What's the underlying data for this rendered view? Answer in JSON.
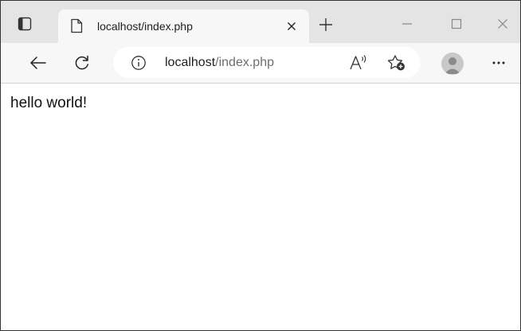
{
  "browser": {
    "tab": {
      "title": "localhost/index.php",
      "favicon_icon": "page-icon",
      "close_icon": "close-icon"
    },
    "new_tab_icon": "plus-icon",
    "window_controls": [
      "minimize-icon",
      "maximize-icon",
      "close-icon"
    ],
    "tab_actions_icon": "tab-actions-icon"
  },
  "toolbar": {
    "back_icon": "back-arrow-icon",
    "refresh_icon": "refresh-icon",
    "address": {
      "host": "localhost",
      "path": "/index.php",
      "info_icon": "info-icon"
    },
    "read_aloud_icon": "read-aloud-icon",
    "favorites_icon": "add-favorite-icon",
    "profile_icon": "avatar",
    "more_icon": "more-icon"
  },
  "page": {
    "body_text": "hello world!"
  },
  "colors": {
    "tabstrip": "#e4e4e4",
    "toolbar": "#f7f7f7",
    "address_bar": "#ffffff",
    "text": "#1e1e1e",
    "muted_text": "#6e6e6e"
  }
}
